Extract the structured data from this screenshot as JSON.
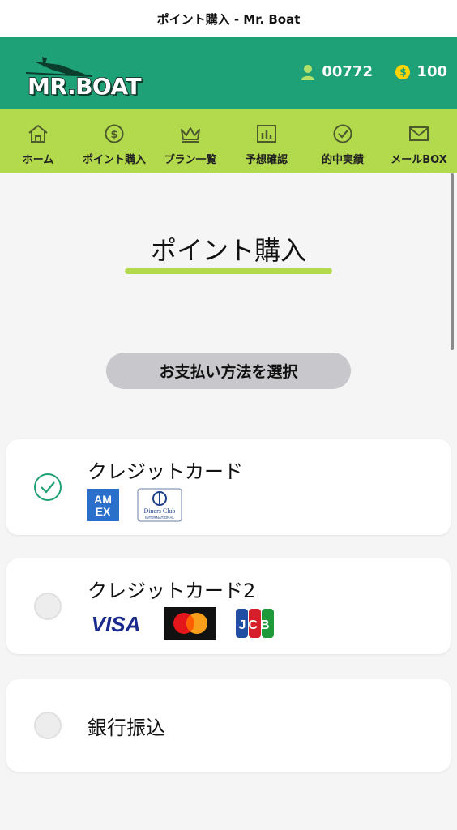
{
  "window": {
    "title": "ポイント購入 - Mr. Boat"
  },
  "header": {
    "logo_text": "MR.BOAT",
    "user_id": "00772",
    "points": "100",
    "coin_symbol": "$",
    "colors": {
      "header_bg": "#1fa177",
      "nav_bg": "#b3d94c"
    }
  },
  "nav": {
    "items": [
      {
        "label": "ホーム",
        "icon": "home-icon"
      },
      {
        "label": "ポイント購入",
        "icon": "dollar-coin-icon"
      },
      {
        "label": "プラン一覧",
        "icon": "crown-icon"
      },
      {
        "label": "予想確認",
        "icon": "bar-chart-icon"
      },
      {
        "label": "的中実績",
        "icon": "check-circle-icon"
      },
      {
        "label": "メールBOX",
        "icon": "mail-icon"
      }
    ]
  },
  "main": {
    "title": "ポイント購入",
    "select_label": "お支払い方法を選択",
    "methods": [
      {
        "label": "クレジットカード",
        "selected": true,
        "brands": [
          "AMEX",
          "Diners Club International"
        ]
      },
      {
        "label": "クレジットカード2",
        "selected": false,
        "brands": [
          "VISA",
          "Mastercard",
          "JCB"
        ]
      },
      {
        "label": "銀行振込",
        "selected": false,
        "brands": []
      }
    ]
  },
  "brand_text": {
    "amex_line1": "AM",
    "amex_line2": "EX",
    "diners_line1": "Diners Club",
    "diners_line2": "INTERNATIONAL",
    "visa": "VISA",
    "jcb": "JCB"
  }
}
